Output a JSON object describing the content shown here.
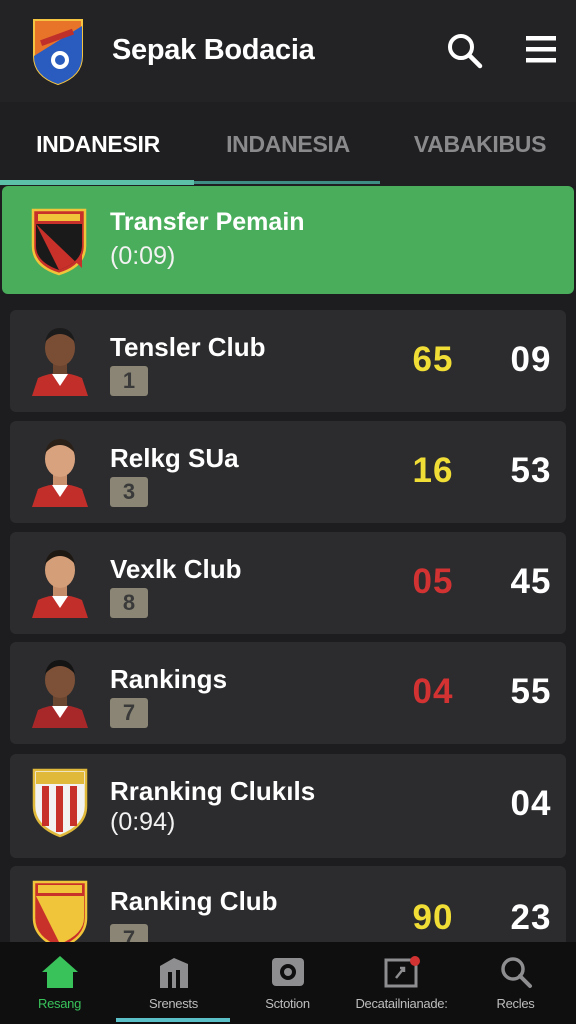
{
  "header": {
    "title": "Sepak Bodacia",
    "search_icon": "search-icon",
    "menu_icon": "menu-icon"
  },
  "tabs": [
    {
      "label": "INDANESIR",
      "active": true
    },
    {
      "label": "INDANESIA",
      "active": false
    },
    {
      "label": "VABAKIBUS",
      "active": false
    }
  ],
  "banner": {
    "title": "Transfer Pemain",
    "subtitle": "(0:09)",
    "color": "#4aad5c"
  },
  "list": [
    {
      "name": "Tensler Club",
      "rank": "1",
      "score_a": "65",
      "score_b": "09",
      "score_a_color": "yellow"
    },
    {
      "name": "Relkg SUa",
      "rank": "3",
      "score_a": "16",
      "score_b": "53",
      "score_a_color": "yellow"
    },
    {
      "name": "Vexlk Club",
      "rank": "8",
      "score_a": "05",
      "score_b": "45",
      "score_a_color": "red"
    },
    {
      "name": "Rankings",
      "rank": "7",
      "score_a": "04",
      "score_b": "55",
      "score_a_color": "red"
    },
    {
      "name": "Rranking Clukıls",
      "subtitle": "(0:94)",
      "score_b": "04"
    },
    {
      "name": "Ranking Club",
      "rank": "7",
      "score_a": "90",
      "score_b": "23",
      "score_a_color": "yellow"
    }
  ],
  "bottom_nav": [
    {
      "label": "Resang",
      "icon": "home-icon",
      "active": true
    },
    {
      "label": "Srenests",
      "icon": "stadium-icon",
      "active": false
    },
    {
      "label": "Sctotion",
      "icon": "camera-icon",
      "active": false
    },
    {
      "label": "Decatailnianade:",
      "icon": "notification-screen-icon",
      "active": false
    },
    {
      "label": "Recles",
      "icon": "search-icon",
      "active": false
    }
  ],
  "colors": {
    "accent_green": "#4aad5c",
    "score_yellow": "#f0dd35",
    "score_red": "#d33232",
    "nav_active": "#39c25a"
  }
}
